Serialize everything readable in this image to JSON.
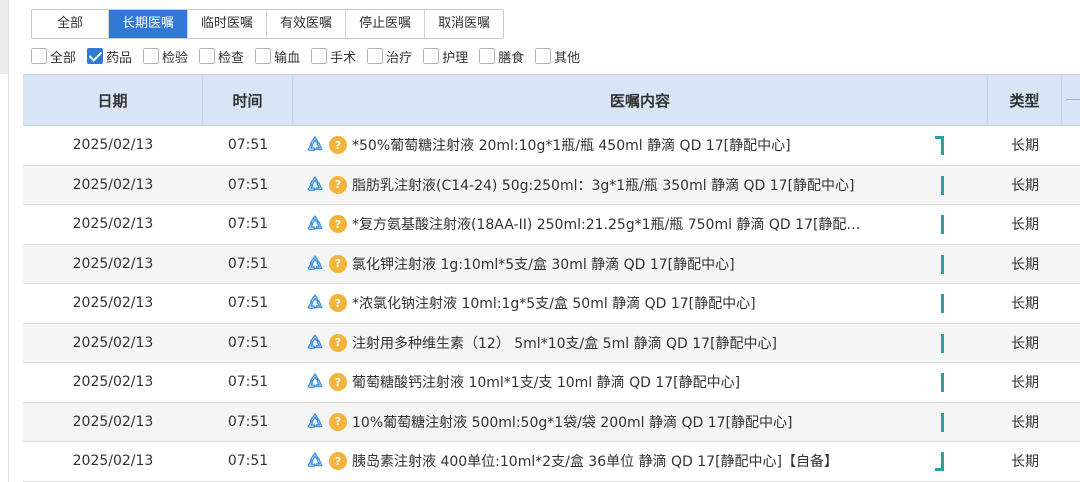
{
  "order_tabs": [
    "全部",
    "长期医嘱",
    "临时医嘱",
    "有效医嘱",
    "停止医嘱",
    "取消医嘱"
  ],
  "active_tab": 1,
  "filters": [
    {
      "label": "全部",
      "checked": false
    },
    {
      "label": "药品",
      "checked": true
    },
    {
      "label": "检验",
      "checked": false
    },
    {
      "label": "检查",
      "checked": false
    },
    {
      "label": "输血",
      "checked": false
    },
    {
      "label": "手术",
      "checked": false
    },
    {
      "label": "治疗",
      "checked": false
    },
    {
      "label": "护理",
      "checked": false
    },
    {
      "label": "膳食",
      "checked": false
    },
    {
      "label": "其他",
      "checked": false
    }
  ],
  "table": {
    "headers": {
      "date": "日期",
      "time": "时间",
      "content": "医嘱内容",
      "type": "类型"
    },
    "rows": [
      {
        "date": "2025/02/13",
        "time": "07:51",
        "content": "*50%葡萄糖注射液 20ml:10g*1瓶/瓶 450ml 静滴 QD 17[静配中心]",
        "type": "长期",
        "coin": "?",
        "group": "top"
      },
      {
        "date": "2025/02/13",
        "time": "07:51",
        "content": "脂肪乳注射液(C14-24) 50g:250ml：3g*1瓶/瓶 350ml 静滴 QD 17[静配中心]",
        "type": "长期",
        "coin": "?",
        "group": "mid"
      },
      {
        "date": "2025/02/13",
        "time": "07:51",
        "content": "*复方氨基酸注射液(18AA-II) 250ml:21.25g*1瓶/瓶 750ml 静滴 QD 17[静配…",
        "type": "长期",
        "coin": "?",
        "group": "mid"
      },
      {
        "date": "2025/02/13",
        "time": "07:51",
        "content": "氯化钾注射液 1g:10ml*5支/盒 30ml 静滴 QD 17[静配中心]",
        "type": "长期",
        "coin": "?",
        "group": "mid"
      },
      {
        "date": "2025/02/13",
        "time": "07:51",
        "content": "*浓氯化钠注射液 10ml:1g*5支/盒 50ml 静滴 QD 17[静配中心]",
        "type": "长期",
        "coin": "?",
        "group": "mid"
      },
      {
        "date": "2025/02/13",
        "time": "07:51",
        "content": "注射用多种维生素（12） 5ml*10支/盒 5ml 静滴 QD 17[静配中心]",
        "type": "长期",
        "coin": "?",
        "group": "mid"
      },
      {
        "date": "2025/02/13",
        "time": "07:51",
        "content": "葡萄糖酸钙注射液 10ml*1支/支 10ml 静滴 QD 17[静配中心]",
        "type": "长期",
        "coin": "?",
        "group": "mid"
      },
      {
        "date": "2025/02/13",
        "time": "07:51",
        "content": "10%葡萄糖注射液 500ml:50g*1袋/袋 200ml 静滴 QD 17[静配中心]",
        "type": "长期",
        "coin": "?",
        "group": "mid"
      },
      {
        "date": "2025/02/13",
        "time": "07:51",
        "content": "胰岛素注射液 400单位:10ml*2支/盒 36单位 静滴 QD 17[静配中心]【自备】",
        "type": "长期",
        "coin": "?",
        "group": "bottom"
      }
    ]
  },
  "colors": {
    "accent": "#3279d6",
    "header_bg": "#d9e4f7",
    "marker": "#2aa3a0",
    "coin": "#f4b33a"
  },
  "icons": {
    "row_status": "recycle-icon",
    "row_badge": "coin-icon"
  }
}
